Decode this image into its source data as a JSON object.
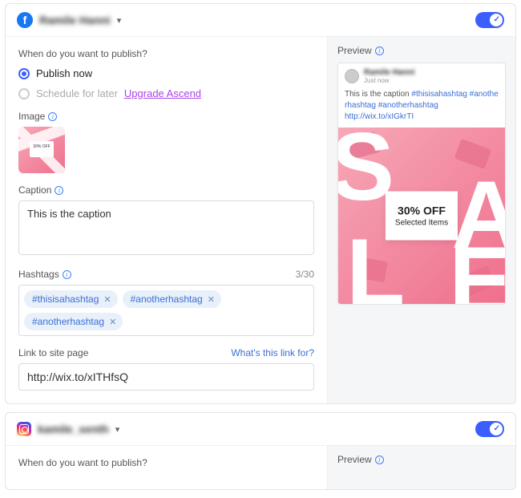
{
  "facebook": {
    "account_name": "Ramile Hanni",
    "publish_q": "When do you want to publish?",
    "opt_now": "Publish now",
    "opt_later": "Schedule for later",
    "upgrade": "Upgrade Ascend",
    "image_label": "Image",
    "caption_label": "Caption",
    "caption_value": "This is the caption",
    "hashtags_label": "Hashtags",
    "hashtags_counter": "3/30",
    "hashtags": [
      "#thisisahashtag",
      "#anotherhashtag",
      "#anotherhashtag"
    ],
    "link_label": "Link to site page",
    "link_help": "What's this link for?",
    "link_value": "http://wix.to/xITHfsQ",
    "preview_label": "Preview",
    "preview": {
      "name": "Ramile Hanni",
      "time": "Just now",
      "caption_text": "This is the caption",
      "hashtag_text": "#thisisahashtag #anotherhashtag #anotherhashtag",
      "link": "http://wix.to/xIGkrTI",
      "offer_headline": "30% OFF",
      "offer_sub": "Selected Items"
    }
  },
  "instagram": {
    "account_name": "kamile_senth",
    "publish_q": "When do you want to publish?",
    "preview_label": "Preview"
  }
}
